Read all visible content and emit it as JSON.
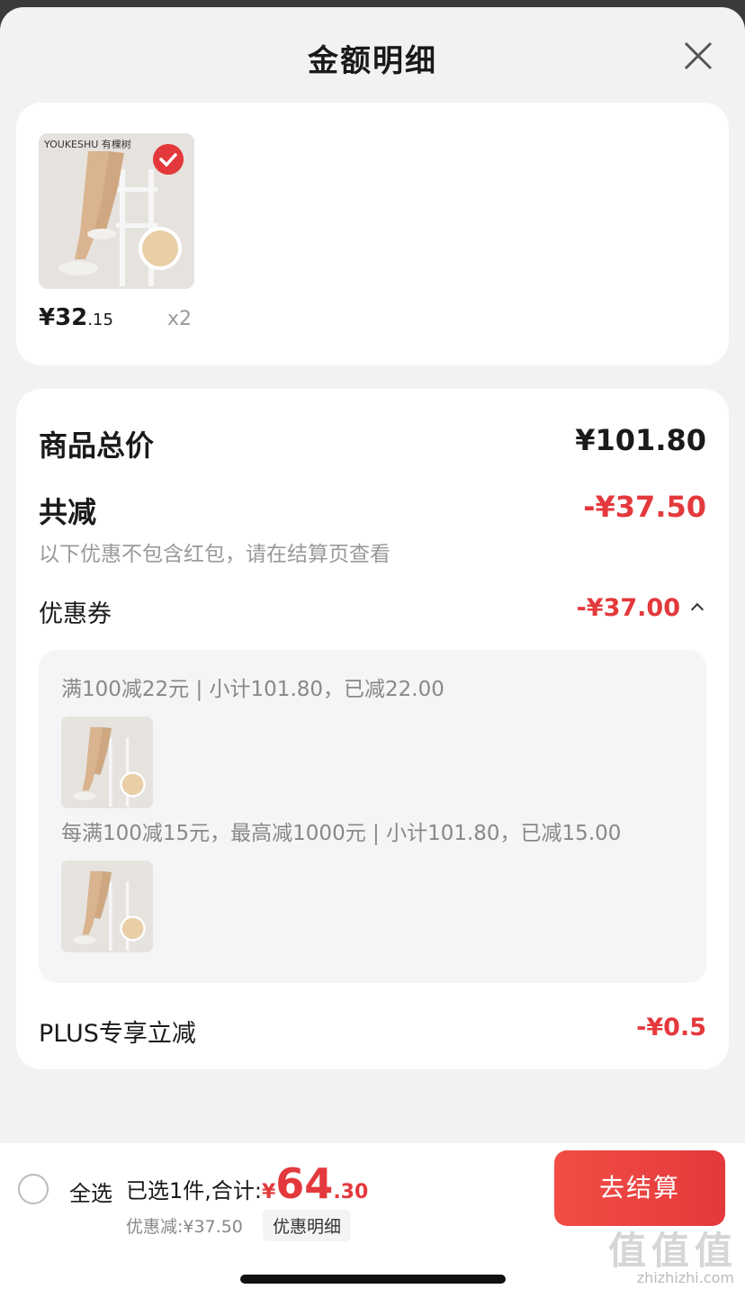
{
  "header": {
    "title": "金额明细"
  },
  "product": {
    "brand": "YOUKESHU 有棵树",
    "price_yuan": "¥32",
    "price_cents": ".15",
    "quantity": "x2"
  },
  "breakdown": {
    "total_label": "商品总价",
    "total_value": "¥101.80",
    "reduce_label": "共减",
    "reduce_value": "-¥37.50",
    "note": "以下优惠不包含红包，请在结算页查看",
    "coupon_label": "优惠券",
    "coupon_value": "-¥37.00",
    "rules": [
      "满100减22元 | 小计101.80，已减22.00",
      "每满100减15元，最高减1000元 | 小计101.80，已减15.00"
    ],
    "plus_label": "PLUS专享立减",
    "plus_value": "-¥0.5"
  },
  "footer": {
    "select_all": "全选",
    "selected_text": "已选1件,合计:",
    "total_symbol": "¥",
    "total_int": "64",
    "total_dec": ".30",
    "discount_text": "优惠减:¥37.50",
    "discount_detail_btn": "优惠明细",
    "checkout_btn": "去结算"
  },
  "watermark": {
    "main": "值值值",
    "sub": "zhizhizhi.com"
  },
  "colors": {
    "accent": "#e4393c",
    "background": "#f2f2f2"
  },
  "icons": [
    "close-icon",
    "check-icon",
    "chevron-up-icon",
    "radio-icon"
  ]
}
